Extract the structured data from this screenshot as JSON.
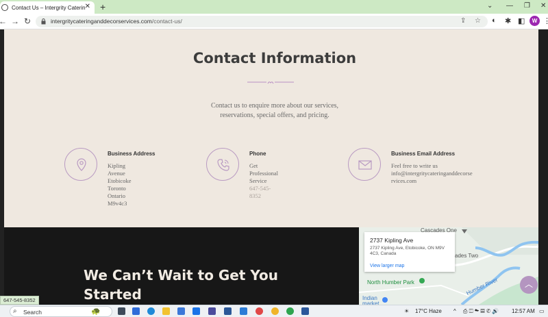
{
  "browser": {
    "tab_title": "Contact Us – Intergrity Catering",
    "tab_close": "✕",
    "new_tab": "+",
    "url_domain": "intergritycateringanddecorservices.com",
    "url_path": "/contact-us/",
    "profile_initial": "W"
  },
  "contact": {
    "title": "Contact Information",
    "intro_line1": "Contact us to enquire more about our services,",
    "intro_line2": "reservations, special offers, and pricing.",
    "items": [
      {
        "heading": "Business Address",
        "line1": "Kipling Avenue Etobicoke",
        "line2": "Toronto Ontario M9v4c3",
        "icon": "location-pin-icon"
      },
      {
        "heading": "Phone",
        "line1": "Get Professional Service",
        "line2": "647-545-8352",
        "icon": "phone-icon"
      },
      {
        "heading": "Business Email Address",
        "line1": "Feel free to write us",
        "line2": "info@intergritycateringanddecorse",
        "line3": "rvices.com",
        "icon": "envelope-icon"
      }
    ]
  },
  "cta": {
    "line1": "We Can’t Wait to Get You",
    "line2": "Started"
  },
  "map": {
    "place_title": "2737 Kipling Ave",
    "address": "2737 Kipling Ave, Etobicoke, ON M9V 4C3, Canada",
    "link": "View larger map",
    "labels": {
      "cascades_one": "Cascades One",
      "cascades_two": "ades Two",
      "north_humber": "North Humber Park",
      "humber_river": "Humber River",
      "indian_line": "Indian",
      "market": "market"
    }
  },
  "status_bar": "647-545-8352",
  "taskbar": {
    "search_label": "Search",
    "weather": "17°C  Haze",
    "time": "12:57 AM"
  },
  "colors": {
    "tabbar": "#cde9c4",
    "page_bg": "#efe8e0",
    "accent_purple": "#b495c0",
    "dark_bg": "#171717"
  }
}
